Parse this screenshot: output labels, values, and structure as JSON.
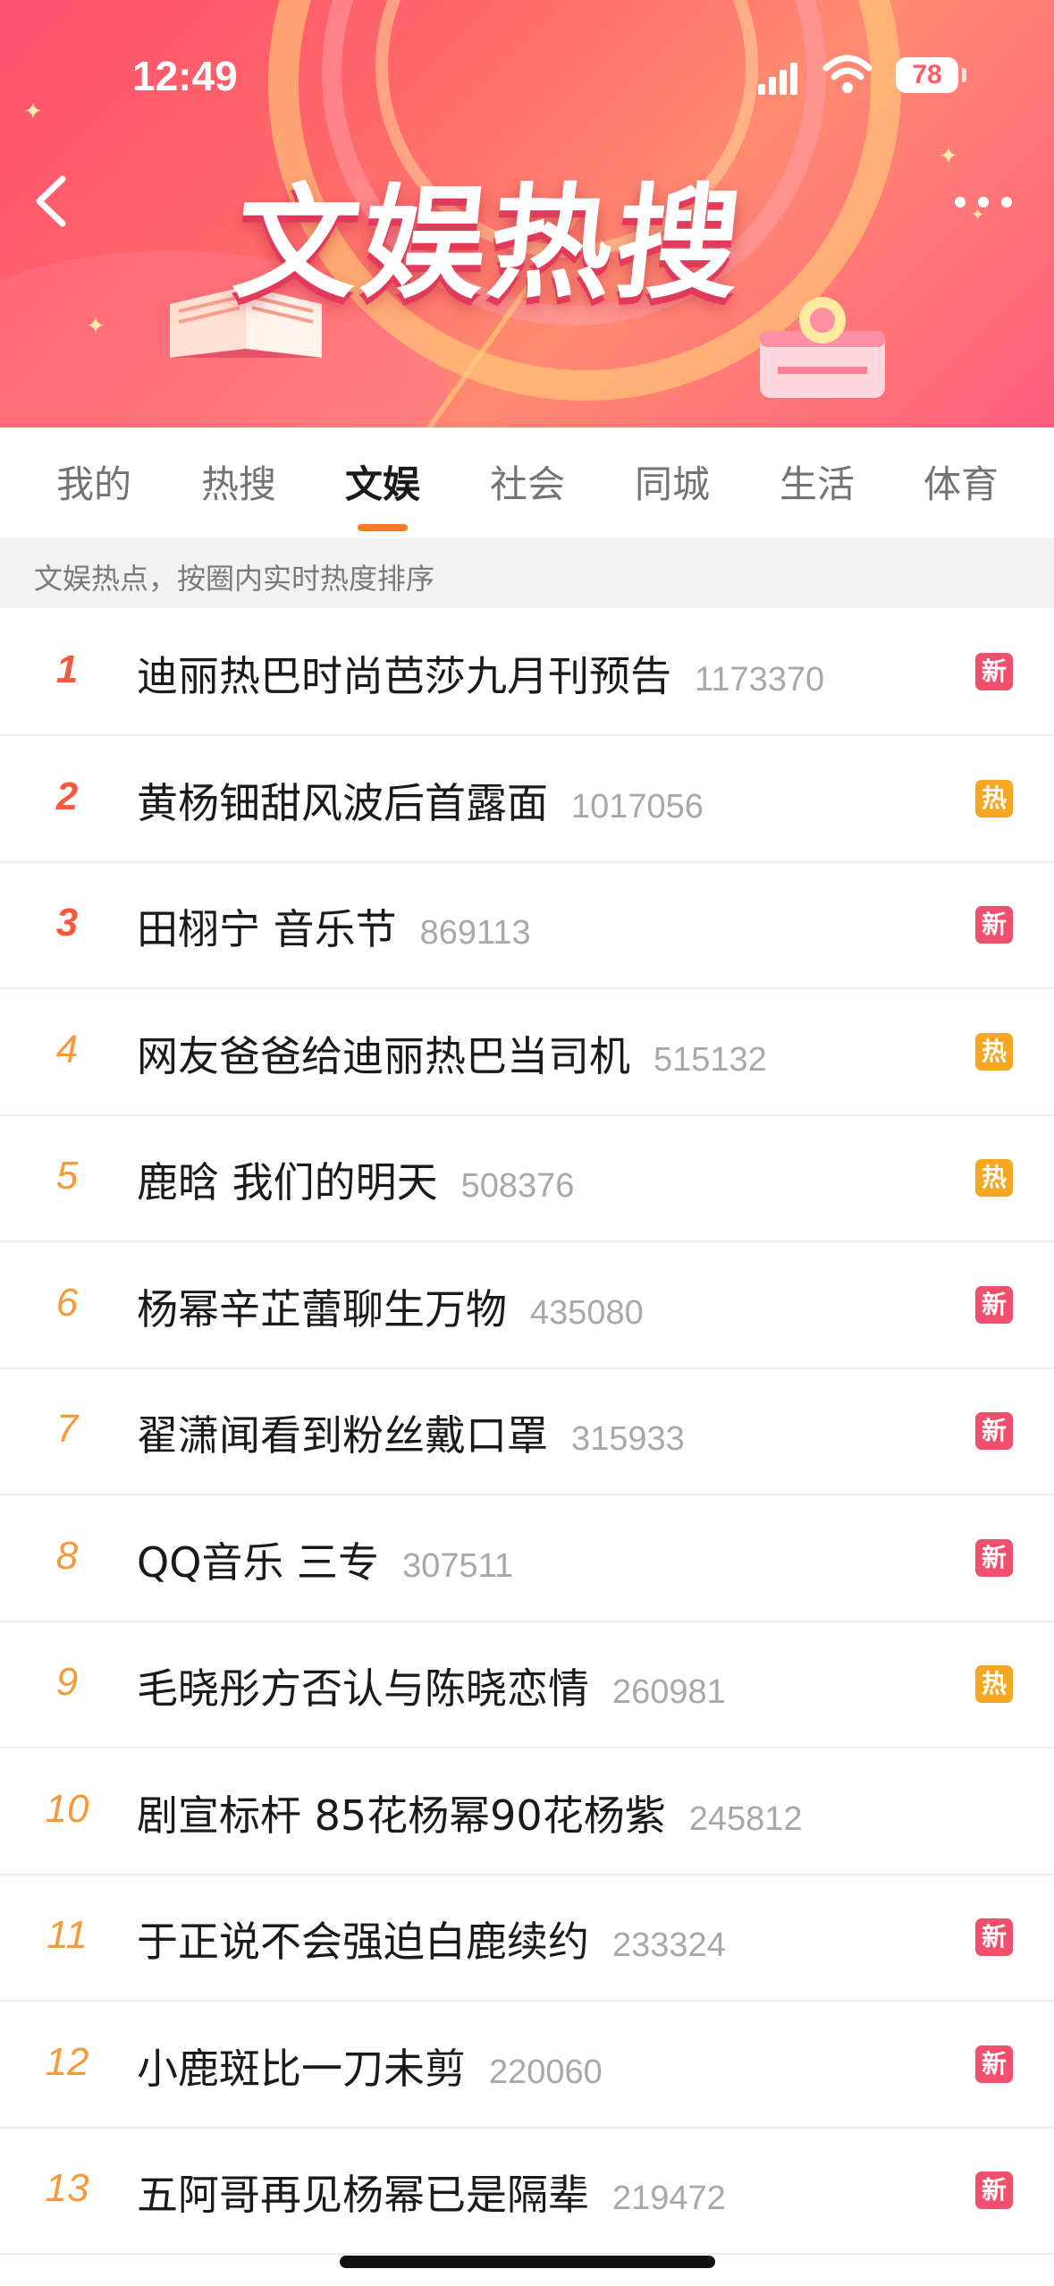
{
  "status_bar": {
    "time": "12:49",
    "battery": "78"
  },
  "banner": {
    "title": "文娱热搜"
  },
  "tabs": [
    {
      "label": "我的"
    },
    {
      "label": "热搜"
    },
    {
      "label": "文娱"
    },
    {
      "label": "社会"
    },
    {
      "label": "同城"
    },
    {
      "label": "生活"
    },
    {
      "label": "体育"
    }
  ],
  "active_tab": "文娱",
  "subtitle": "文娱热点，按圈内实时热度排序",
  "colors": {
    "accent": "#ff7a22",
    "badge_new": "#f0506e",
    "badge_hot": "#f5a623",
    "rank_top3": "#f55a3c",
    "rank_other": "#f59a3a"
  },
  "items": [
    {
      "rank": "1",
      "title": "迪丽热巴时尚芭莎九月刊预告",
      "count": "1173370",
      "badge": "新",
      "badge_type": "new"
    },
    {
      "rank": "2",
      "title": "黄杨钿甜风波后首露面",
      "count": "1017056",
      "badge": "热",
      "badge_type": "hot"
    },
    {
      "rank": "3",
      "title": "田栩宁 音乐节",
      "count": "869113",
      "badge": "新",
      "badge_type": "new"
    },
    {
      "rank": "4",
      "title": "网友爸爸给迪丽热巴当司机",
      "count": "515132",
      "badge": "热",
      "badge_type": "hot"
    },
    {
      "rank": "5",
      "title": "鹿晗 我们的明天",
      "count": "508376",
      "badge": "热",
      "badge_type": "hot"
    },
    {
      "rank": "6",
      "title": "杨幂辛芷蕾聊生万物",
      "count": "435080",
      "badge": "新",
      "badge_type": "new"
    },
    {
      "rank": "7",
      "title": "翟潇闻看到粉丝戴口罩",
      "count": "315933",
      "badge": "新",
      "badge_type": "new"
    },
    {
      "rank": "8",
      "title": "QQ音乐 三专",
      "count": "307511",
      "badge": "新",
      "badge_type": "new"
    },
    {
      "rank": "9",
      "title": "毛晓彤方否认与陈晓恋情",
      "count": "260981",
      "badge": "热",
      "badge_type": "hot"
    },
    {
      "rank": "10",
      "title": "剧宣标杆 85花杨幂90花杨紫",
      "count": "245812",
      "badge": "",
      "badge_type": "none"
    },
    {
      "rank": "11",
      "title": "于正说不会强迫白鹿续约",
      "count": "233324",
      "badge": "新",
      "badge_type": "new"
    },
    {
      "rank": "12",
      "title": "小鹿斑比一刀未剪",
      "count": "220060",
      "badge": "新",
      "badge_type": "new"
    },
    {
      "rank": "13",
      "title": "五阿哥再见杨幂已是隔辈",
      "count": "219472",
      "badge": "新",
      "badge_type": "new"
    }
  ]
}
